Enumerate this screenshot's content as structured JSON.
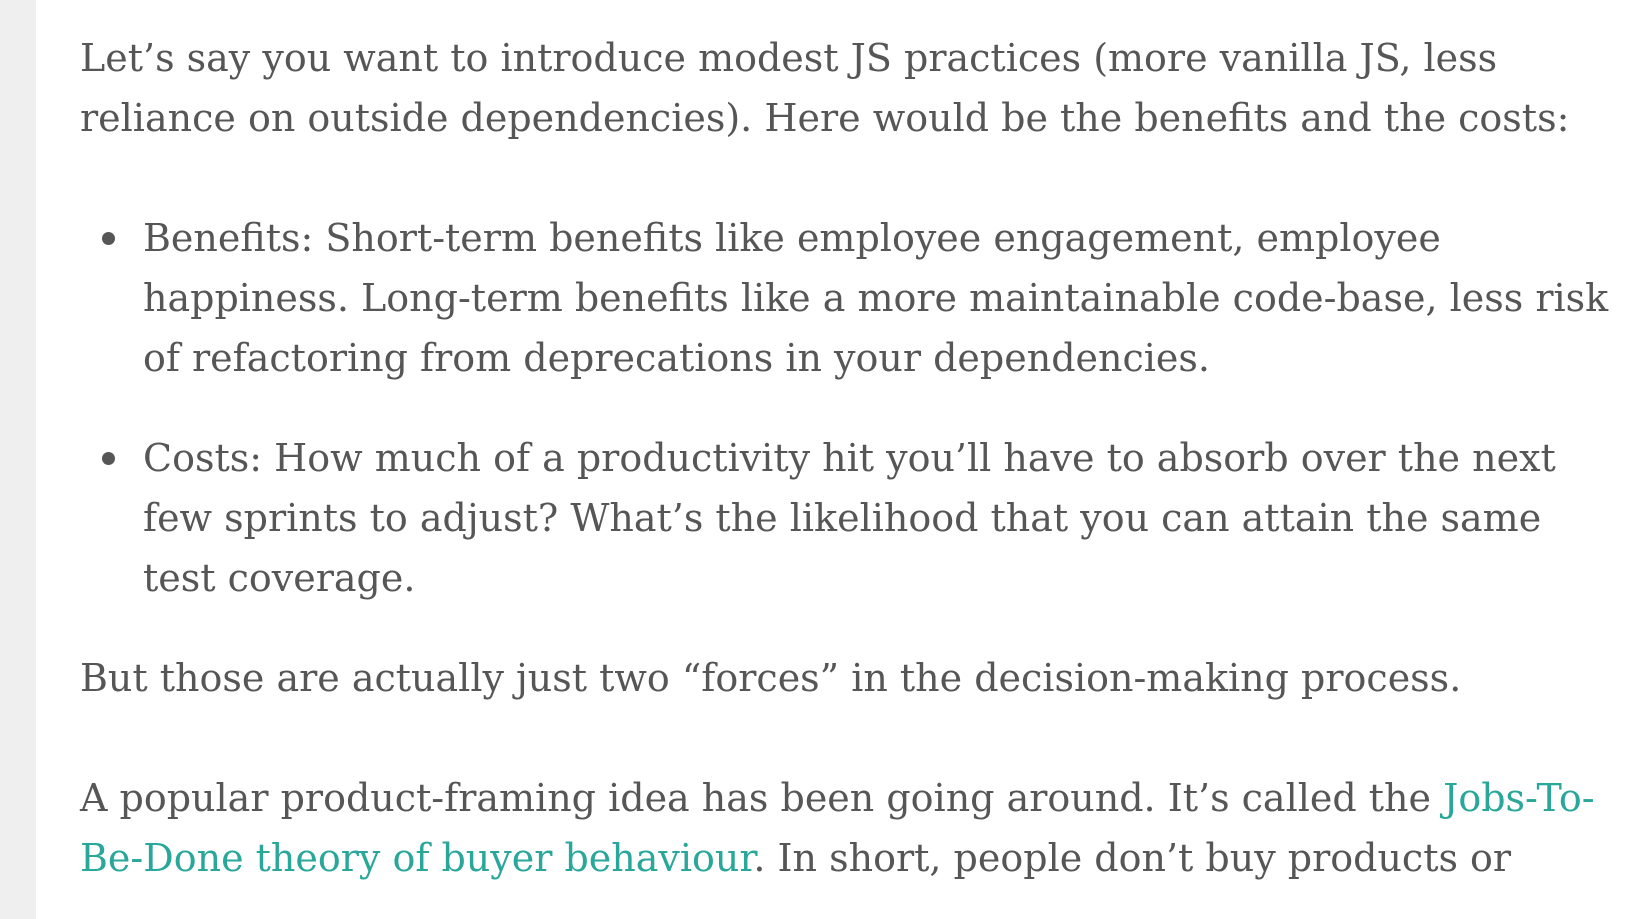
{
  "article": {
    "intro": "Let’s say you want to introduce modest JS practices (more vanilla JS, less reliance on outside dependencies). Here would be the benefits and the costs:",
    "bullets": [
      "Benefits: Short-term benefits like employee engagement, employee happiness. Long-term benefits like a more maintainable code-base, less risk of refactoring from deprecations in your dependencies.",
      "Costs: How much of a productivity hit you’ll have to absorb over the next few sprints to adjust? What’s the likelihood that you can attain the same test coverage."
    ],
    "forces": "But those are actually just two “forces” in the decision-making process.",
    "jtbd_before": "A popular product-framing idea has been going around. It’s called the ",
    "jtbd_link": "Jobs-To-Be-Done theory of buyer behaviour",
    "jtbd_after": ". In short, people don’t buy products or"
  },
  "colors": {
    "text": "#565656",
    "link": "#2aa79b",
    "sidebar": "#efefef"
  }
}
